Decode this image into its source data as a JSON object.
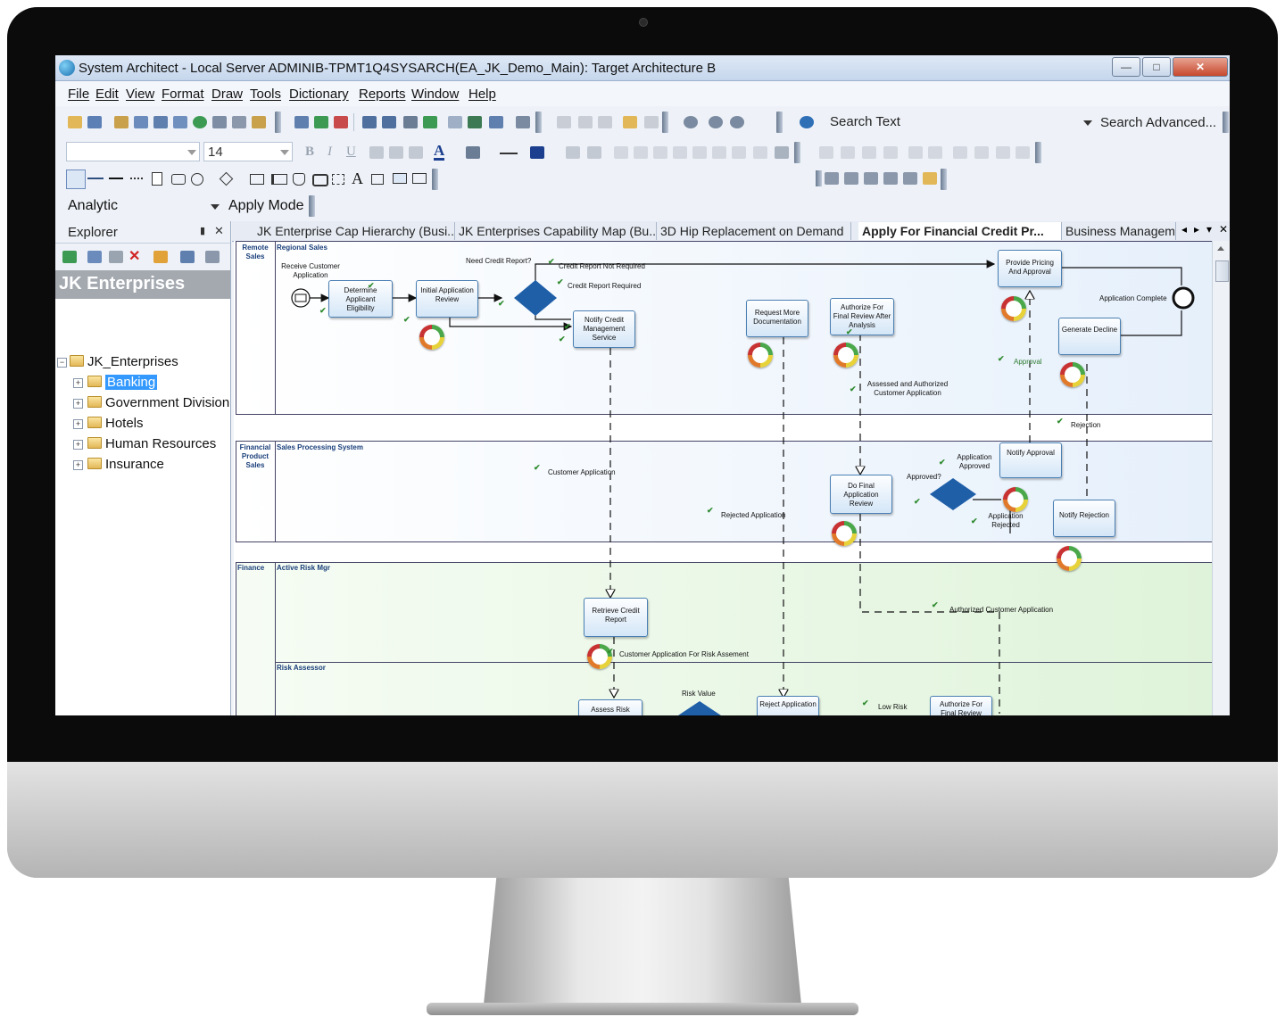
{
  "window": {
    "title": "System Architect - Local Server ADMINIB-TPMT1Q4SYSARCH(EA_JK_Demo_Main): Target Architecture B",
    "minimize": "—",
    "maximize": "□",
    "close": "✕"
  },
  "menu": [
    "File",
    "Edit",
    "View",
    "Format",
    "Draw",
    "Tools",
    "Dictionary",
    "Reports",
    "Window",
    "Help"
  ],
  "toolbar": {
    "font_size": "14",
    "search_text": "Search Text",
    "search_advanced": "Search Advanced...",
    "bold": "B",
    "italic": "I",
    "underline": "U",
    "text_tool": "A"
  },
  "mode": {
    "value": "Analytic",
    "apply_label": "Apply Mode"
  },
  "explorer": {
    "title": "Explorer",
    "pin": "▮",
    "close": "✕",
    "banner": "JK Enterprises",
    "root": "JK_Enterprises",
    "items": [
      "Banking",
      "Government Division",
      "Hotels",
      "Human Resources",
      "Insurance"
    ],
    "selected": "Banking"
  },
  "tabs": [
    "JK Enterprise Cap Hierarchy (Busi...",
    "JK Enterprises Capability Map (Bu...",
    "3D Hip Replacement on Demand",
    "Apply For Financial Credit Pr...",
    "Business Manageme"
  ],
  "active_tab": "Apply For Financial Credit Pr...",
  "tab_controls": {
    "prev": "◂",
    "next": "▸",
    "menu": "▾",
    "close": "✕"
  },
  "diagram": {
    "pools": [
      {
        "name": "Remote Sales",
        "lanes": [
          "Regional Sales"
        ]
      },
      {
        "name": "Financial Product Sales",
        "lanes": [
          "Sales Processing System"
        ]
      },
      {
        "name": "Finance",
        "lanes": [
          "Active Risk Mgr",
          "Risk Assessor"
        ]
      }
    ],
    "activities": {
      "receive": "Receive Customer Application",
      "determine": "Determine Applicant Eligibility",
      "initial_review": "Initial Application Review",
      "notify_cms": "Notify Credit Management Service",
      "request_docs": "Request More Documentation",
      "authorize_final": "Authorize For Final Review After Analysis",
      "provide_pricing": "Provide Pricing And Approval",
      "generate_decline": "Generate Decline",
      "notify_approval": "Notify Approval",
      "do_final_review": "Do Final Application Review",
      "notify_rejection": "Notify Rejection",
      "retrieve_credit": "Retrieve Credit Report",
      "assess_risk": "Assess Risk",
      "reject_application": "Reject Application",
      "authorize_final_review": "Authorize For Final Review"
    },
    "labels": {
      "need_credit": "Need Credit Report?",
      "not_required": "Credit Report Not Required",
      "required": "Credit Report Required",
      "app_complete": "Application Complete",
      "approval": "Approval",
      "assessed": "Assessed and Authorized Customer Application",
      "rejection": "Rejection",
      "customer_application": "Customer Application",
      "rejected_application": "Rejected Application",
      "approved_q": "Approved?",
      "application_approved": "Application Approved",
      "application_rejected": "Application Rejected",
      "authorized_customer": "Authorized Customer Application",
      "for_risk": "Customer Application For Risk Assement",
      "risk_value": "Risk Value",
      "low_risk": "Low Risk"
    }
  },
  "colors": {
    "accent": "#4a7fb3",
    "gateway": "#1f5fa8",
    "pool_top_bg": "#e9f2fb",
    "pool_finance_bg": "#e3f5de",
    "selection": "#3399ff"
  }
}
